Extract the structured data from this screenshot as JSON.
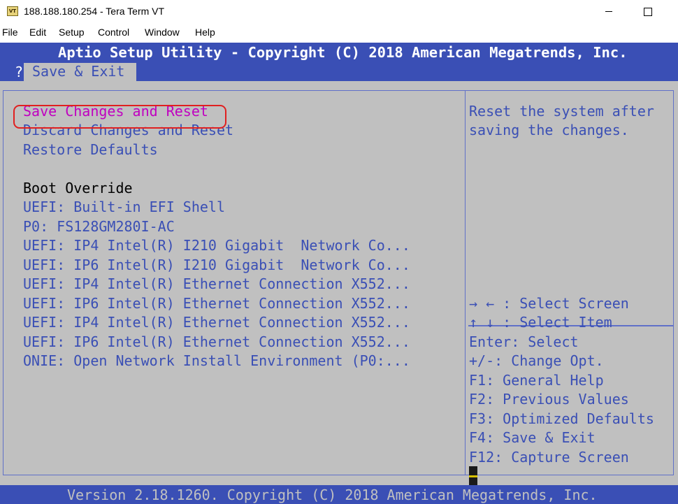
{
  "window": {
    "app_icon": "VT",
    "title": "188.188.180.254 - Tera Term VT",
    "minimize_glyph": "minimize-icon",
    "maximize_glyph": "maximize-icon"
  },
  "menubar": [
    "File",
    "Edit",
    "Setup",
    "Control",
    "Window",
    "Help"
  ],
  "bios": {
    "title": "Aptio Setup Utility - Copyright (C) 2018 American Megatrends, Inc.",
    "tab_prefix": "?",
    "active_tab": "Save & Exit",
    "menu": {
      "items": [
        "Save Changes and Reset",
        "Discard Changes and Reset",
        "Restore Defaults"
      ],
      "section_title": "Boot Override",
      "boot_options": [
        "UEFI: Built-in EFI Shell",
        "P0: FS128GM280I-AC",
        "UEFI: IP4 Intel(R) I210 Gigabit  Network Co...",
        "UEFI: IP6 Intel(R) I210 Gigabit  Network Co...",
        "UEFI: IP4 Intel(R) Ethernet Connection X552...",
        "UEFI: IP6 Intel(R) Ethernet Connection X552...",
        "UEFI: IP4 Intel(R) Ethernet Connection X552...",
        "UEFI: IP6 Intel(R) Ethernet Connection X552...",
        "ONIE: Open Network Install Environment (P0:..."
      ]
    },
    "help": [
      "Reset the system after",
      "saving the changes."
    ],
    "keys": [
      "→ ← : Select Screen",
      "↑ ↓ : Select Item",
      "Enter: Select",
      "+/-: Change Opt.",
      "F1: General Help",
      "F2: Previous Values",
      "F3: Optimized Defaults",
      "F4: Save & Exit",
      "F12: Capture Screen"
    ],
    "footer": "Version 2.18.1260. Copyright (C) 2018 American Megatrends, Inc."
  },
  "colors": {
    "header_blue": "#3a4fb5",
    "body_gray": "#c0c0c0",
    "selected_magenta": "#c000c0",
    "annotation_red": "#e02020"
  }
}
